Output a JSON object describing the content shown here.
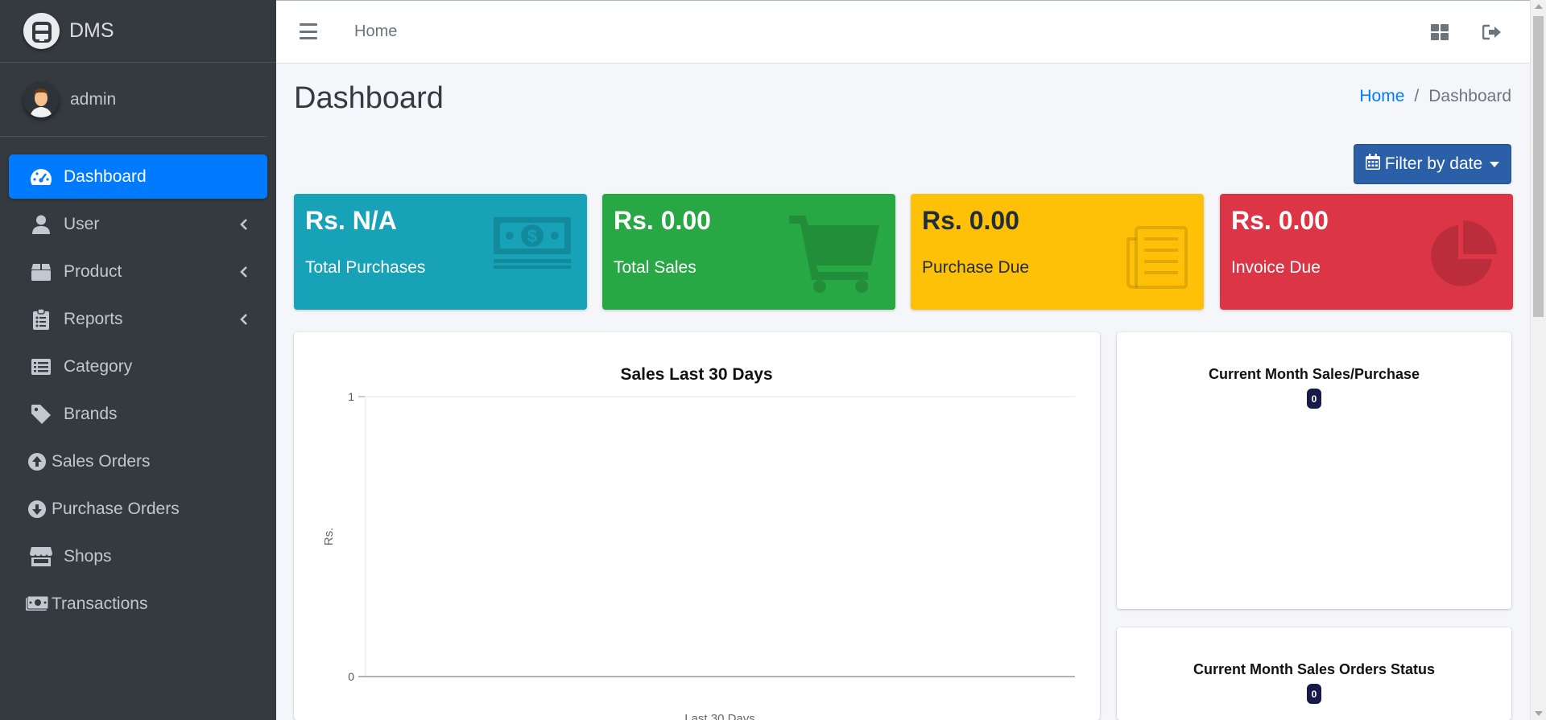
{
  "brand": {
    "name": "DMS"
  },
  "user": {
    "name": "admin"
  },
  "sidebar": {
    "items": [
      {
        "label": "Dashboard",
        "icon": "tachometer-icon",
        "active": true
      },
      {
        "label": "User",
        "icon": "user-icon",
        "has_children": true
      },
      {
        "label": "Product",
        "icon": "box-icon",
        "has_children": true
      },
      {
        "label": "Reports",
        "icon": "clipboard-list-icon",
        "has_children": true
      },
      {
        "label": "Category",
        "icon": "list-alt-icon"
      },
      {
        "label": "Brands",
        "icon": "tag-icon"
      },
      {
        "label": "Sales Orders",
        "icon": "arrow-circle-up-icon"
      },
      {
        "label": "Purchase Orders",
        "icon": "arrow-circle-down-icon"
      },
      {
        "label": "Shops",
        "icon": "store-icon"
      },
      {
        "label": "Transactions",
        "icon": "money-bill-icon"
      }
    ]
  },
  "topbar": {
    "home_label": "Home"
  },
  "page": {
    "title": "Dashboard",
    "breadcrumb": {
      "home": "Home",
      "separator": "/",
      "current": "Dashboard"
    },
    "filter_label": "Filter by date"
  },
  "stats": [
    {
      "value": "Rs. N/A",
      "label": "Total Purchases",
      "color": "#17a2b8",
      "icon": "money-bill-icon"
    },
    {
      "value": "Rs. 0.00",
      "label": "Total Sales",
      "color": "#28a745",
      "icon": "shopping-cart-icon"
    },
    {
      "value": "Rs. 0.00",
      "label": "Purchase Due",
      "color": "#ffc107",
      "icon": "newspaper-icon"
    },
    {
      "value": "Rs. 0.00",
      "label": "Invoice Due",
      "color": "#dc3545",
      "icon": "pie-chart-icon"
    }
  ],
  "cards": {
    "month_title": "Current Month Sales/Purchase",
    "month_badge": "0",
    "status_title": "Current Month Sales Orders Status",
    "status_badge": "0"
  },
  "chart_data": {
    "type": "line",
    "title": "Sales Last 30 Days",
    "xlabel": "Last 30 Days",
    "ylabel": "Rs.",
    "ylim": [
      0,
      1
    ],
    "y_ticks": [
      "1",
      "0"
    ],
    "series": []
  }
}
